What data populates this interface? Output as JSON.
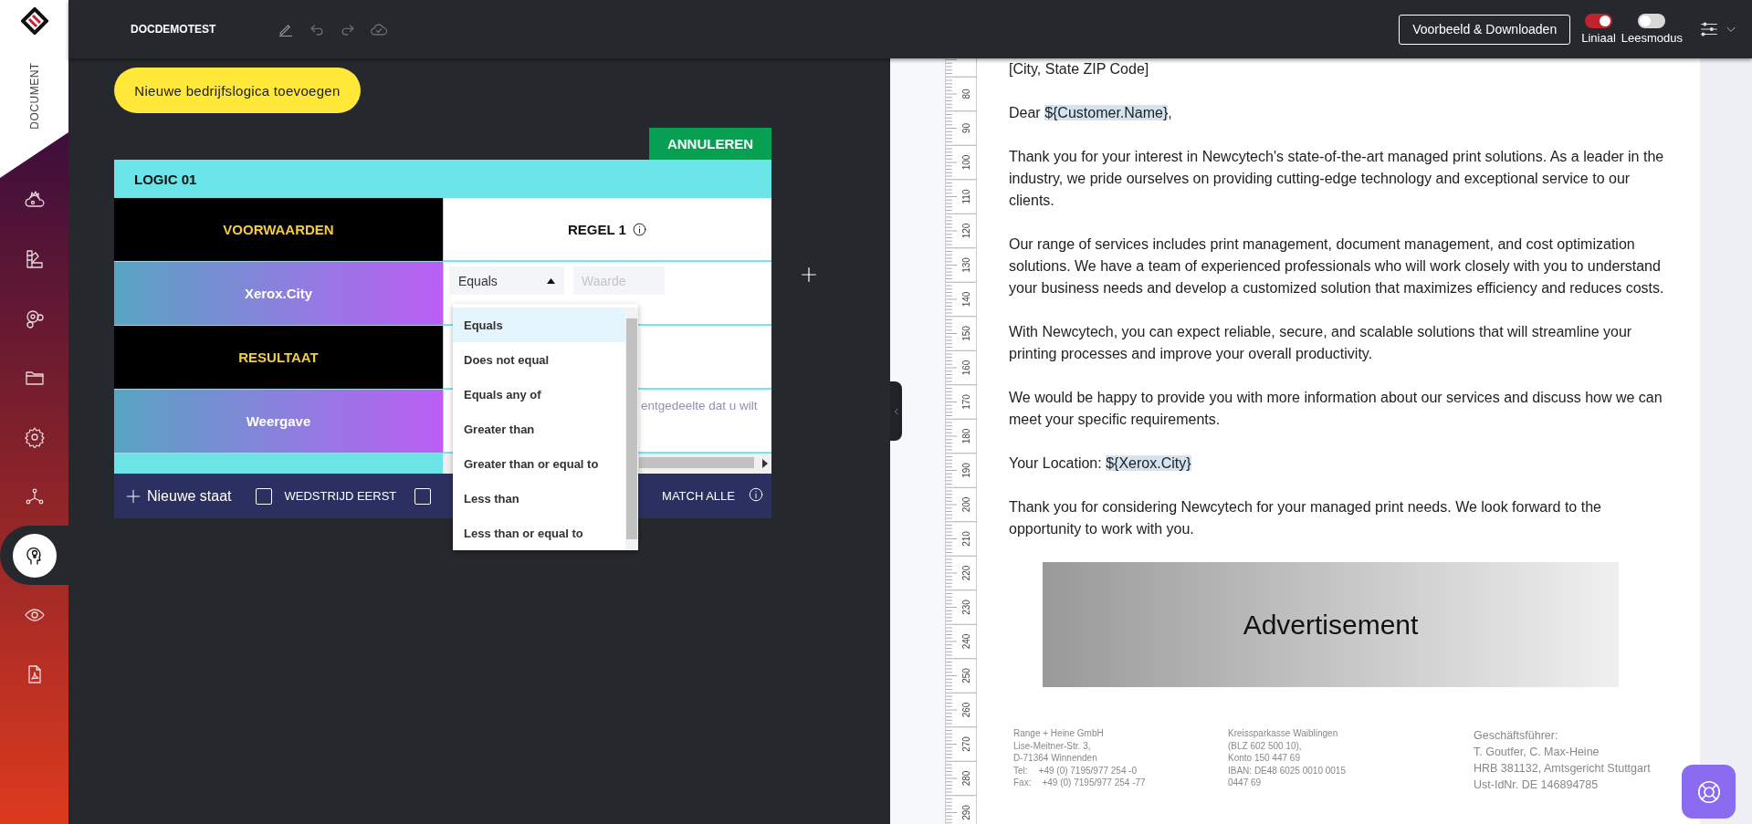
{
  "sidebar": {
    "title": "DOCUMENT",
    "items": [
      {
        "selected": false
      },
      {
        "selected": false
      },
      {
        "selected": false
      },
      {
        "selected": false
      },
      {
        "selected": false
      },
      {
        "selected": false
      },
      {
        "selected": true
      },
      {
        "selected": false
      },
      {
        "selected": false
      }
    ]
  },
  "topbar": {
    "title": "DOCDEMOTEST",
    "preview_button": "Voorbeeld & Downloaden",
    "toggles": [
      {
        "label": "Liniaal",
        "on": true
      },
      {
        "label": "Leesmodus",
        "on": false
      }
    ]
  },
  "logic": {
    "add_button": "Nieuwe bedrijfslogica toevoegen",
    "cancel_button": "ANNULEREN",
    "title": "LOGIC 01",
    "rows": [
      {
        "kind": "header",
        "label": "VOORWAARDEN"
      },
      {
        "kind": "condition",
        "label": "Xerox.City"
      },
      {
        "kind": "header",
        "label": "RESULTAAT"
      },
      {
        "kind": "output",
        "label": "Weergave"
      }
    ],
    "rule": {
      "title": "REGEL 1",
      "operator": "Equals",
      "value_placeholder": "Waarde",
      "output_placeholder": "entgedeelte dat u wilt"
    },
    "dropdown": [
      {
        "label": "Equals",
        "selected": true
      },
      {
        "label": "Does not equal",
        "selected": false
      },
      {
        "label": "Equals any of",
        "selected": false
      },
      {
        "label": "Greater than",
        "selected": false
      },
      {
        "label": "Greater than or equal to",
        "selected": false
      },
      {
        "label": "Less than",
        "selected": false
      },
      {
        "label": "Less than or equal to",
        "selected": false
      }
    ],
    "footer": {
      "new_state": "Nieuwe staat",
      "checkboxes": [
        {
          "label": "WEDSTRIJD EERST",
          "checked": false
        },
        {
          "checked": false
        }
      ],
      "match": "MATCH ALLE"
    }
  },
  "document": {
    "ruler": [
      "80",
      "90",
      "100",
      "110",
      "120",
      "130",
      "140",
      "150",
      "160",
      "170",
      "180",
      "190",
      "200",
      "210",
      "220",
      "230",
      "240",
      "250",
      "260",
      "270",
      "280",
      "290"
    ],
    "paragraphs": [
      {
        "text": "[City, State ZIP Code]"
      },
      {
        "before": "Dear ",
        "field": "${Customer.Name}",
        "after": ","
      },
      {
        "text": "Thank you for your interest in Newcytech's state-of-the-art managed print solutions. As a leader in the industry, we pride ourselves on providing cutting-edge technology and exceptional service to our clients."
      },
      {
        "text": "Our range of services includes print management, document management, and cost optimization solutions. We have a team of experienced professionals who will work closely with you to understand your business needs and develop a customized solution that maximizes efficiency and reduces costs."
      },
      {
        "text": "With Newcytech, you can expect reliable, secure, and scalable solutions that will streamline your printing processes and improve your overall productivity."
      },
      {
        "text": "We would be happy to provide you with more information about our services and discuss how we can meet your specific requirements."
      },
      {
        "before": "Your Location: ",
        "field": "${Xerox.City}"
      },
      {
        "text": "Thank you for considering Newcytech for your managed print needs. We look forward to the opportunity to work with you."
      }
    ],
    "advertisement": "Advertisement",
    "footer": {
      "company": [
        "Range + Heine GmbH",
        "Lise-Meitner-Str. 3,",
        "D-71364 Winnenden"
      ],
      "contacts": [
        {
          "label": "Tel:",
          "value": "+49 (0) 7195/977 254 -0"
        },
        {
          "label": "Fax:",
          "value": "+49 (0) 7195/977 254 -77"
        }
      ],
      "bank": [
        "Kreissparkasse Waiblingen",
        "(BLZ 602 500 10),",
        "Konto 150 447 69",
        "IBAN: DE48 6025 0010 0015",
        "0447 69"
      ],
      "management": [
        "Geschäftsführer:",
        "T. Goutfer, C. Max-Heine",
        "HRB 381132, Amtsgericht Stuttgart",
        "Ust-IdNr. DE 146894785"
      ]
    }
  }
}
